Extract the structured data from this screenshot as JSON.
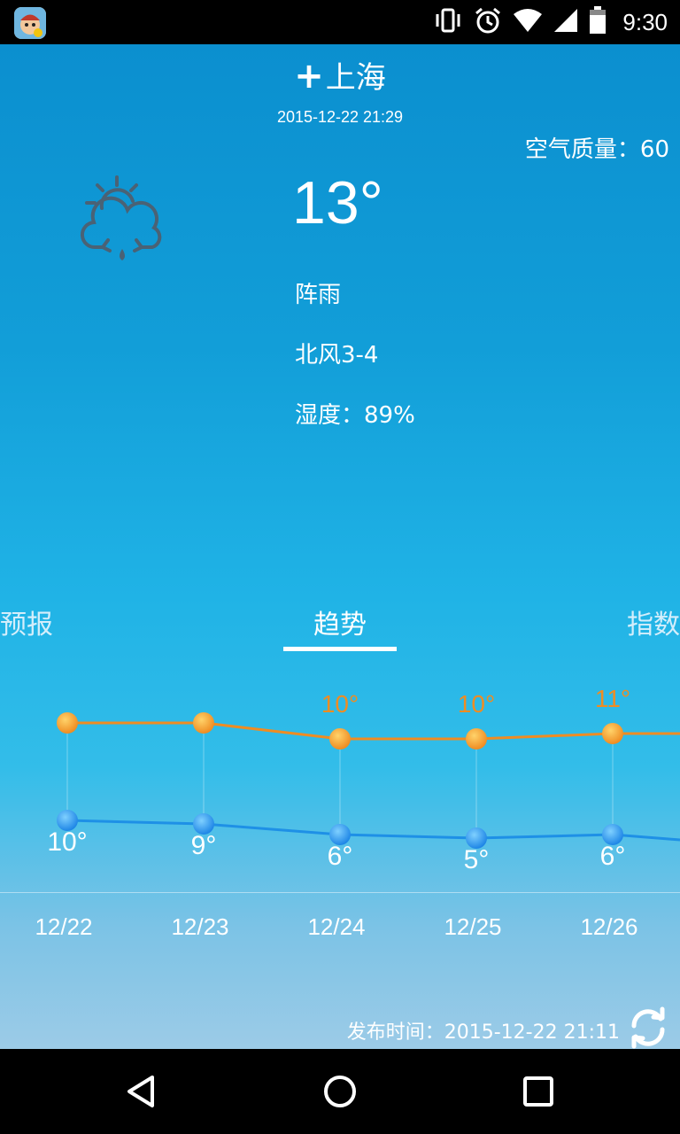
{
  "status_bar": {
    "time": "9:30",
    "icons": [
      "vibrate-icon",
      "alarm-icon",
      "wifi-icon",
      "signal-icon",
      "battery-icon"
    ]
  },
  "header": {
    "add_symbol": "+",
    "city": "上海",
    "update_time": "2015-12-22  21:29",
    "aqi": "空气质量：60"
  },
  "current": {
    "icon": "cloud-sun-rain-icon",
    "temperature": "13°",
    "condition": "阵雨",
    "wind": "北风3-4",
    "humidity": "湿度：89%"
  },
  "tabs": [
    {
      "label": "预报"
    },
    {
      "label": "趋势",
      "active": true
    },
    {
      "label": "指数"
    }
  ],
  "chart_data": {
    "type": "line",
    "categories": [
      "12/22",
      "12/23",
      "12/24",
      "12/25",
      "12/26"
    ],
    "series": [
      {
        "values": [
          13,
          13,
          10,
          10,
          11
        ],
        "labels": [
          "",
          "",
          "10°",
          "10°",
          "11°"
        ],
        "color": "#ef8c22"
      },
      {
        "values": [
          10,
          9,
          6,
          5,
          6
        ],
        "labels": [
          "10°",
          "9°",
          "6°",
          "5°",
          "6°"
        ],
        "color": "#1e90e6"
      }
    ]
  },
  "footer": {
    "publish_time": "发布时间：2015-12-22 21:11"
  },
  "colors": {
    "high_line": "#ef8c22",
    "low_line": "#1e90e6",
    "background_top": "#0b8fcf"
  }
}
